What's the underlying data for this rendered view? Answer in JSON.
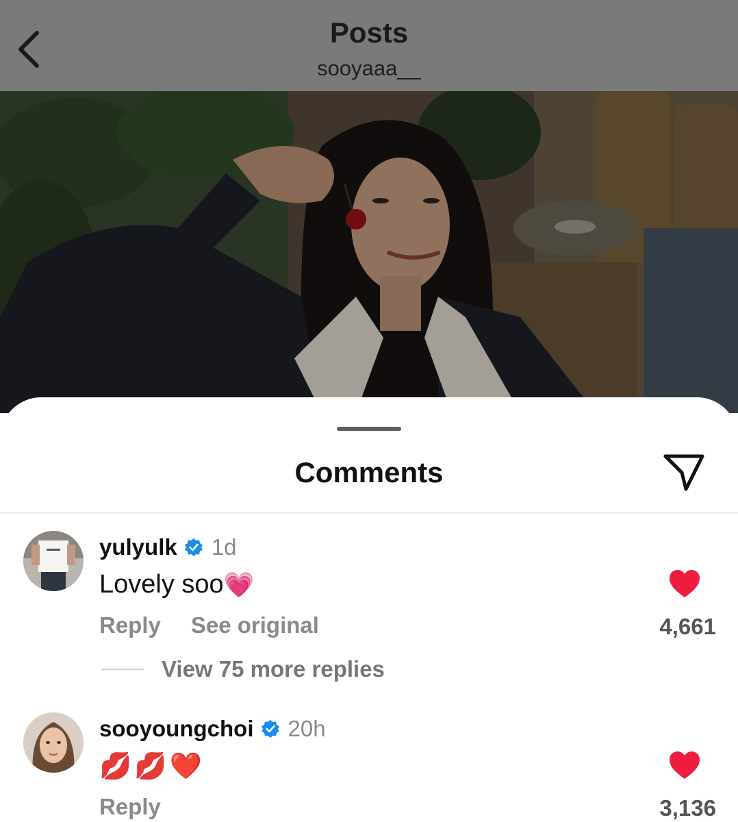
{
  "header": {
    "title": "Posts",
    "subtitle": "sooyaaa__",
    "back_icon": "chevron-left-icon"
  },
  "sheet": {
    "title": "Comments",
    "share_icon": "paper-plane-icon"
  },
  "comments": [
    {
      "username": "yulyulk",
      "verified": true,
      "time": "1d",
      "text": "Lovely soo",
      "text_emoji": "💗",
      "reply_label": "Reply",
      "see_original_label": "See original",
      "like_count": "4,661",
      "view_replies_label": "View 75 more replies"
    },
    {
      "username": "sooyoungchoi",
      "verified": true,
      "time": "20h",
      "text": "",
      "text_emoji": "💋💋❤️",
      "reply_label": "Reply",
      "like_count": "3,136"
    }
  ],
  "colors": {
    "like": "#ee1d40",
    "verified": "#1a8cf0",
    "topbar": "#7a7a7a"
  }
}
